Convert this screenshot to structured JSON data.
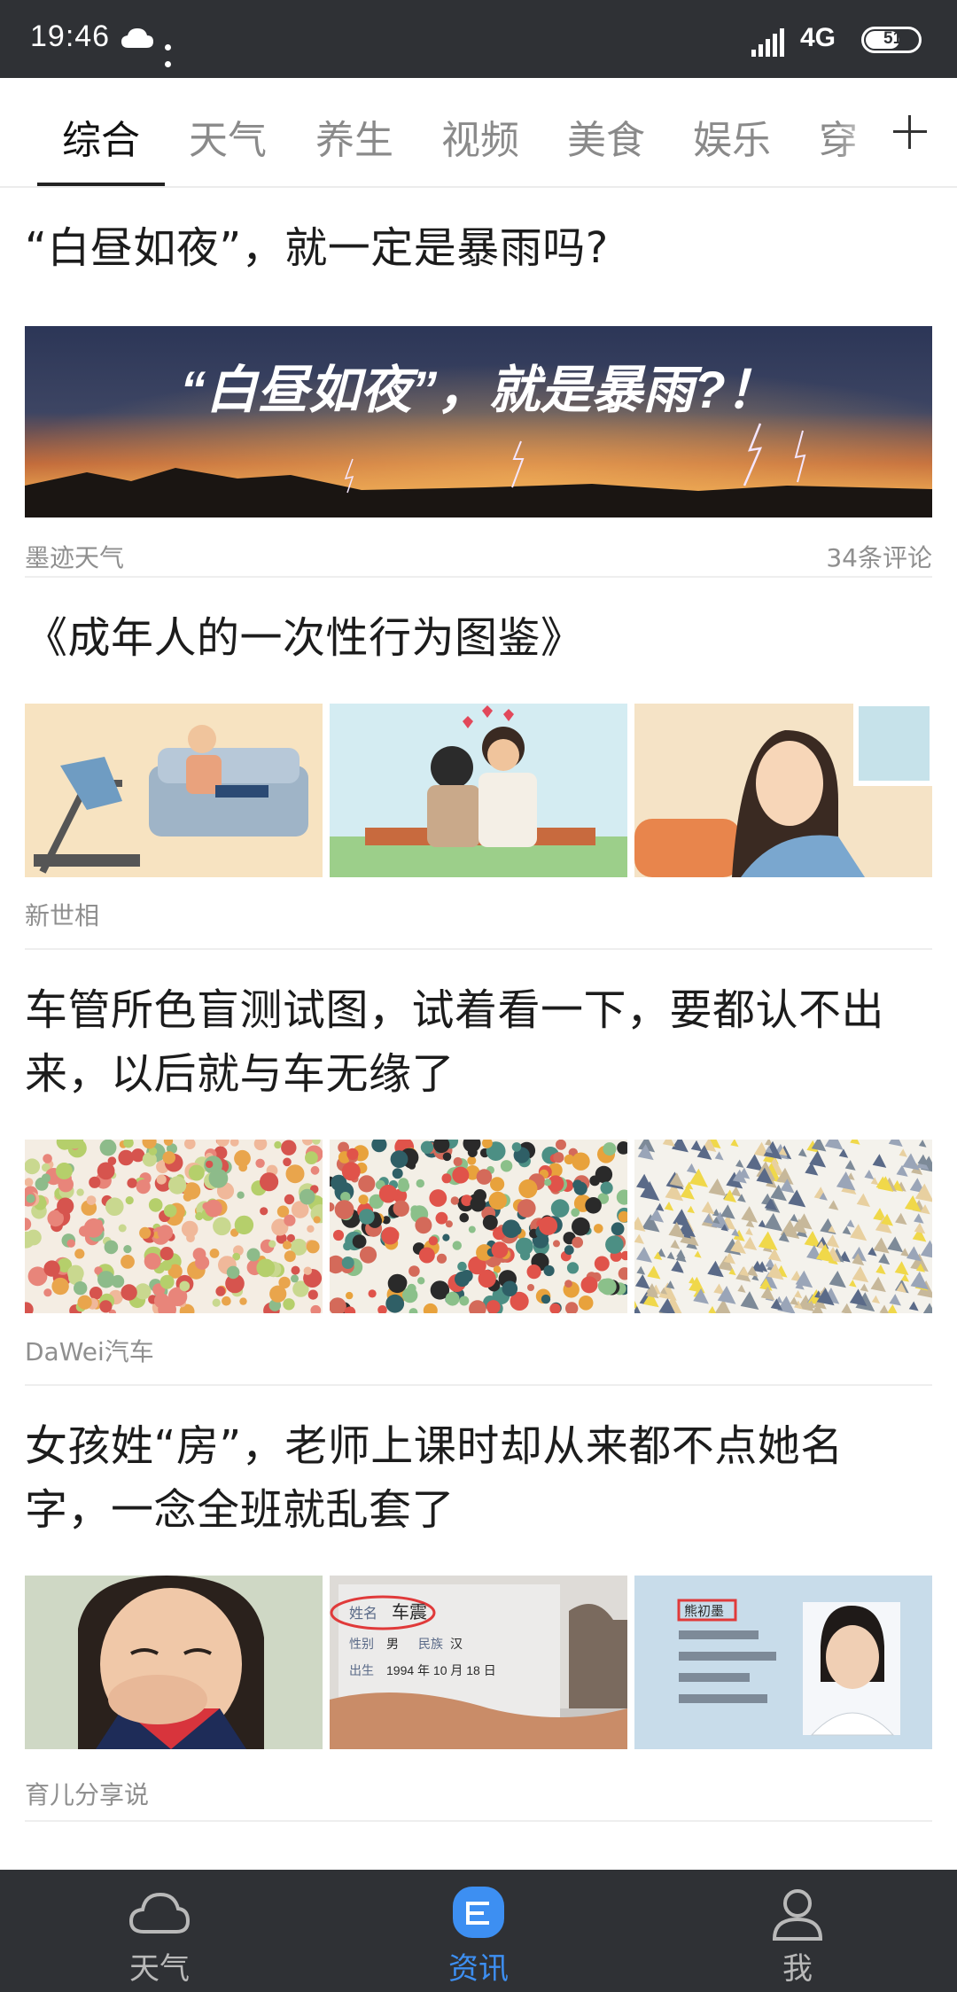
{
  "status_bar": {
    "time": "19:46",
    "network": "4G",
    "battery": "51",
    "weather_icon": "cloud-icon"
  },
  "tabs": [
    {
      "label": "综合",
      "active": true
    },
    {
      "label": "天气",
      "active": false
    },
    {
      "label": "养生",
      "active": false
    },
    {
      "label": "视频",
      "active": false
    },
    {
      "label": "美食",
      "active": false
    },
    {
      "label": "娱乐",
      "active": false
    },
    {
      "label": "穿",
      "active": false
    }
  ],
  "add_tab_icon": "plus-icon",
  "articles": [
    {
      "title": "“白昼如夜”，就一定是暴雨吗?",
      "banner_text": "“白昼如夜”，就是暴雨?！",
      "source": "墨迹天气",
      "comments": "34条评论"
    },
    {
      "title": "《成年人的一次性行为图鉴》",
      "source": "新世相"
    },
    {
      "title_line1": "车管所色盲测试图，试着看一下，要都认不出",
      "title_line2": "来，以后就与车无缘了",
      "source": "DaWei汽车"
    },
    {
      "title_line1": "女孩姓“房”，老师上课时却从来都不点她名",
      "title_line2": "字，一念全班就乱套了",
      "source": "育儿分享说",
      "photo_text": {
        "name_label": "姓名",
        "name_value": "车震",
        "sex_label": "性别",
        "sex_value": "男",
        "nation_label": "民族",
        "nation_value": "汉",
        "birth_label": "出生",
        "birth_value": "1994 年 10 月 18 日",
        "card_name": "熊初墨"
      }
    }
  ],
  "bottom_nav": [
    {
      "label": "天气",
      "icon": "cloud-icon",
      "active": false
    },
    {
      "label": "资讯",
      "icon": "news-icon",
      "active": true
    },
    {
      "label": "我",
      "icon": "person-icon",
      "active": false
    }
  ],
  "colors": {
    "status_bar_bg": "#2f3135",
    "accent": "#3d8ff2",
    "meta_text": "#8f8f8f"
  }
}
